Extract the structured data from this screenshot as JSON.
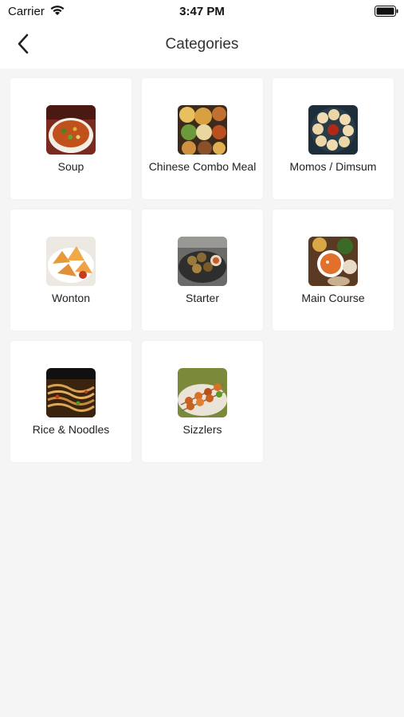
{
  "status_bar": {
    "carrier": "Carrier",
    "time": "3:47 PM"
  },
  "header": {
    "title": "Categories",
    "back_icon": "chevron-left-icon"
  },
  "categories": [
    {
      "label": "Soup",
      "image": "soup-bowl"
    },
    {
      "label": "Chinese Combo Meal",
      "image": "combo-platter"
    },
    {
      "label": "Momos / Dimsum",
      "image": "momos-plate"
    },
    {
      "label": "Wonton",
      "image": "fried-wontons"
    },
    {
      "label": "Starter",
      "image": "starter-plate"
    },
    {
      "label": "Main Course",
      "image": "curry-bowls"
    },
    {
      "label": "Rice & Noodles",
      "image": "noodles"
    },
    {
      "label": "Sizzlers",
      "image": "skewers"
    }
  ]
}
